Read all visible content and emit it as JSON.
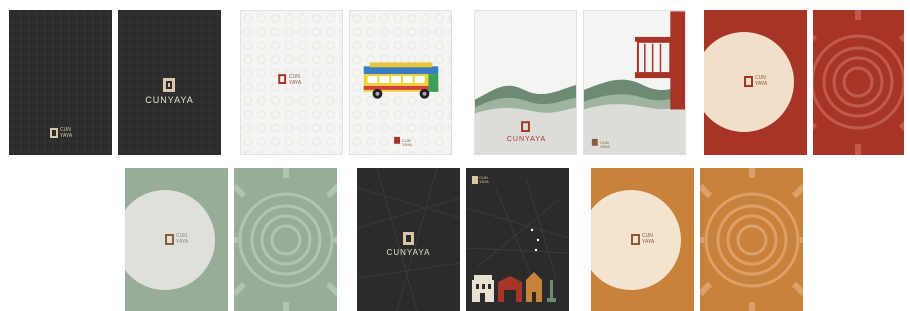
{
  "brand": {
    "name": "CUNYAYA",
    "short_top": "CUN",
    "short_bottom": "YAYA"
  },
  "colors": {
    "charcoal": "#2b2b2b",
    "off_white": "#f4f4f2",
    "sage": "#98ad98",
    "sage_dark": "#6d8a72",
    "brick_red": "#a73527",
    "cream": "#f3dfc9",
    "ochre": "#c9823b",
    "pale_grey": "#dcdcd8",
    "logo_brown": "#8a5a3c"
  },
  "row1": [
    {
      "theme": "dark-texture",
      "variant": "small-logo"
    },
    {
      "theme": "dark-texture",
      "variant": "centered-logo"
    },
    {
      "theme": "white-pattern",
      "variant": "centered-small-logo"
    },
    {
      "theme": "white-pattern",
      "variant": "bus-illustration"
    },
    {
      "theme": "green-waves",
      "variant": "centered-logo"
    },
    {
      "theme": "green-waves",
      "variant": "balcony-illustration"
    },
    {
      "theme": "red-circle",
      "variant": "cream-circle"
    },
    {
      "theme": "red-circle",
      "variant": "sun-motif"
    }
  ],
  "row2": [
    {
      "theme": "sage-circle",
      "variant": "light-circle"
    },
    {
      "theme": "sage-circle",
      "variant": "sun-motif"
    },
    {
      "theme": "dark-lines",
      "variant": "centered-logo"
    },
    {
      "theme": "dark-lines",
      "variant": "map-buildings"
    },
    {
      "theme": "ochre-circle",
      "variant": "cream-circle"
    },
    {
      "theme": "ochre-circle",
      "variant": "sun-motif"
    }
  ]
}
